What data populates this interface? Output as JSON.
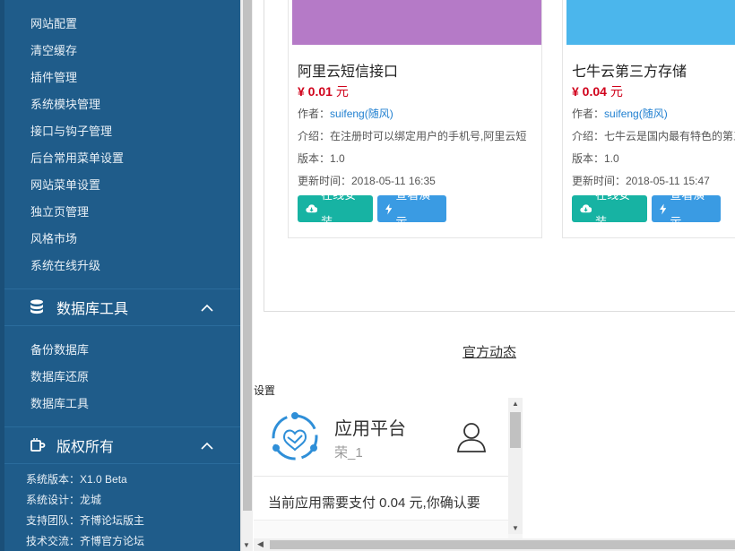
{
  "sidebar": {
    "items": [
      "网站配置",
      "清空缓存",
      "插件管理",
      "系统模块管理",
      "接口与钩子管理",
      "后台常用菜单设置",
      "网站菜单设置",
      "独立页管理",
      "风格市场",
      "系统在线升级"
    ],
    "db_section": {
      "title": "数据库工具",
      "icon": "database-icon",
      "items": [
        "备份数据库",
        "数据库还原",
        "数据库工具"
      ]
    },
    "copyright_section": {
      "title": "版权所有",
      "icon": "coffee-cup-icon",
      "rows": [
        "系统版本：X1.0 Beta",
        "系统设计：龙城",
        "支持团队：齐博论坛版主",
        "技术交流：齐博官方论坛"
      ]
    }
  },
  "cards": [
    {
      "title": "阿里云短信接口",
      "price": "¥ 0.01",
      "price_unit": "元",
      "author_label": "作者：",
      "author": "suifeng(随风)",
      "intro": "介绍：在注册时可以绑定用户的手机号,阿里云短",
      "version": "版本：1.0",
      "updated": "更新时间：2018-05-11 16:35",
      "install_label": "在线安装",
      "demo_label": "查看演示",
      "thumb_color": "#b57ac7"
    },
    {
      "title": "七牛云第三方存储",
      "price": "¥ 0.04",
      "price_unit": "元",
      "author_label": "作者：",
      "author": "suifeng(随风)",
      "intro": "介绍：七牛云是国内最有特色的第三",
      "version": "版本：1.0",
      "updated": "更新时间：2018-05-11 15:47",
      "install_label": "在线安装",
      "demo_label": "查看演示",
      "thumb_color": "#4bb6ec"
    }
  ],
  "official_news": "官方动态",
  "settings_label": "设置",
  "modal": {
    "app_name": "应用平台",
    "user": "荣_1",
    "pay_text": "当前应用需要支付 0.04 元,你确认要"
  }
}
